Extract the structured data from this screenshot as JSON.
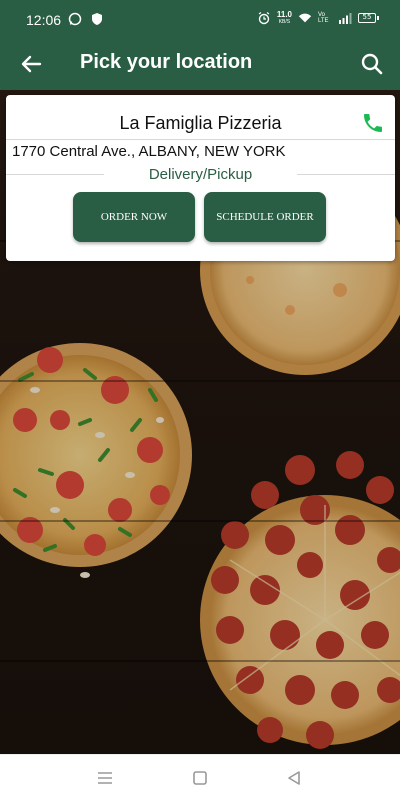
{
  "status_bar": {
    "time": "12:06",
    "speed_value": "11.0",
    "speed_unit": "KB/S",
    "volte": "Vo LTE",
    "battery": "55",
    "icons": [
      "whatsapp-icon",
      "shield-icon",
      "alarm-icon",
      "wifi-icon",
      "signal-icon",
      "battery-icon"
    ]
  },
  "app_bar": {
    "title": "Pick your location",
    "back_icon": "arrow-left-icon",
    "search_icon": "search-icon"
  },
  "location_card": {
    "restaurant_name": "La Famiglia Pizzeria",
    "address": "1770 Central Ave., ALBANY, NEW YORK",
    "mode": "Delivery/Pickup",
    "order_now_label": "ORDER NOW",
    "schedule_order_label": "SCHEDULE ORDER",
    "phone_icon": "phone-icon"
  },
  "nav_bar": {
    "icons": [
      "menu-icon",
      "home-square-icon",
      "back-triangle-icon"
    ]
  },
  "colors": {
    "brand_green": "#2a5e44",
    "phone_green": "#1db954"
  }
}
